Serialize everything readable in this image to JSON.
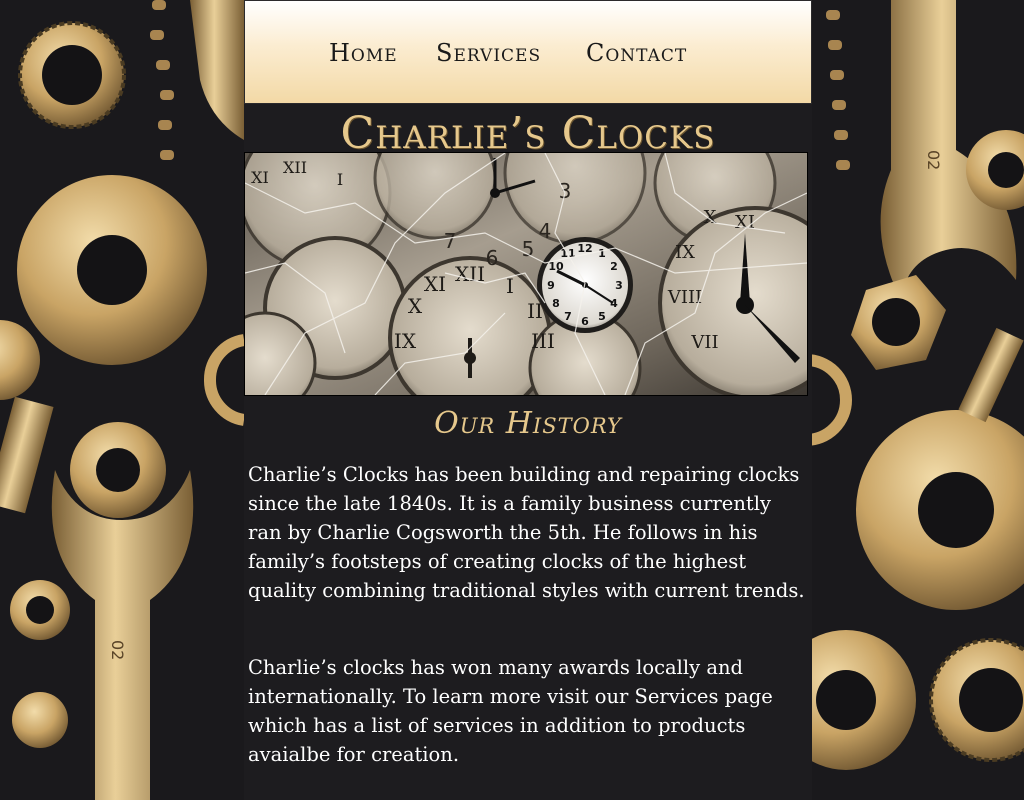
{
  "nav": {
    "items": [
      {
        "label": "Home"
      },
      {
        "label": "Services"
      },
      {
        "label": "Contact"
      }
    ]
  },
  "site": {
    "title": "Charlie’s Clocks"
  },
  "hero": {
    "clock_numerals": [
      "12",
      "1",
      "2",
      "3",
      "4",
      "5",
      "6",
      "7",
      "8",
      "9",
      "10",
      "11"
    ]
  },
  "history": {
    "heading": "Our History",
    "paragraphs": [
      "Charlie’s Clocks has been building and repairing clocks since the late 1840s. It is a family business currently ran by Charlie Cogsworth the 5th. He follows in his family’s footsteps of creating clocks of the highest quality combining traditional styles with current trends.",
      "Charlie’s clocks has won many awards locally and internationally. To learn more visit our Services page which has a list of services in addition to products avaialbe for creation."
    ]
  },
  "decor": {
    "wrench_marking": "02"
  },
  "colors": {
    "page_bg": "#1d1c1f",
    "gold": "#e6c88c",
    "nav_top": "#ffffff",
    "nav_bottom": "#f3d9a6",
    "text": "#ffffff"
  }
}
